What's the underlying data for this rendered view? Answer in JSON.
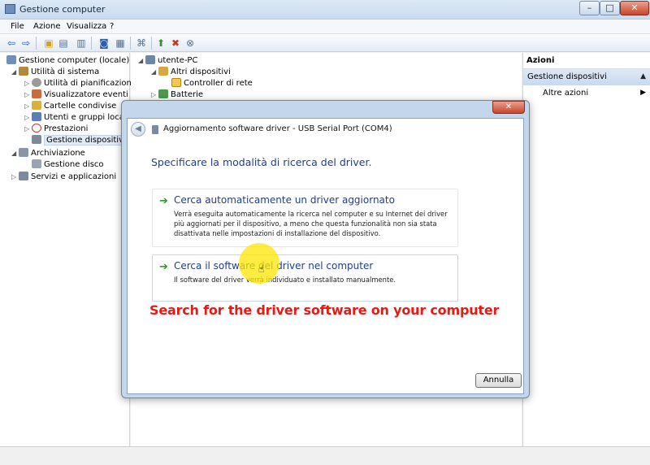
{
  "window": {
    "title": "Gestione computer",
    "controls": {
      "minimize": "–",
      "maximize": "□",
      "close": "✕"
    }
  },
  "menu": [
    "File",
    "Azione",
    "Visualizza",
    "?"
  ],
  "tree_left": [
    {
      "label": "Gestione computer (locale)",
      "icon": "computer-management-icon",
      "expander": ""
    },
    {
      "label": "Utilità di sistema",
      "icon": "system-tools-icon",
      "expander": "◢"
    },
    {
      "label": "Utilità di pianificazione",
      "icon": "task-scheduler-icon",
      "expander": "▷"
    },
    {
      "label": "Visualizzatore eventi",
      "icon": "event-viewer-icon",
      "expander": "▷"
    },
    {
      "label": "Cartelle condivise",
      "icon": "shared-folders-icon",
      "expander": "▷"
    },
    {
      "label": "Utenti e gruppi locali",
      "icon": "users-groups-icon",
      "expander": "▷"
    },
    {
      "label": "Prestazioni",
      "icon": "performance-icon",
      "expander": "▷"
    },
    {
      "label": "Gestione dispositivi",
      "icon": "device-manager-icon",
      "expander": "",
      "selected": true
    },
    {
      "label": "Archiviazione",
      "icon": "storage-icon",
      "expander": "◢"
    },
    {
      "label": "Gestione disco",
      "icon": "disk-management-icon",
      "expander": ""
    },
    {
      "label": "Servizi e applicazioni",
      "icon": "services-apps-icon",
      "expander": "▷"
    }
  ],
  "tree_center": [
    {
      "label": "utente-PC",
      "icon": "computer-icon",
      "expander": "◢"
    },
    {
      "label": "Altri dispositivi",
      "icon": "other-devices-icon",
      "expander": "◢"
    },
    {
      "label": "Controller di rete",
      "icon": "network-controller-warning-icon",
      "expander": ""
    },
    {
      "label": "Batterie",
      "icon": "battery-icon",
      "expander": "▷"
    }
  ],
  "actions": {
    "header": "Azioni",
    "section": "Gestione dispositivi",
    "item": "Altre azioni"
  },
  "dialog": {
    "title": "Aggiornamento software driver - USB Serial Port (COM4)",
    "close": "✕",
    "heading": "Specificare la modalità di ricerca del driver.",
    "options": [
      {
        "title": "Cerca automaticamente un driver aggiornato",
        "description": "Verrà eseguita automaticamente la ricerca nel computer e su Internet dei driver più aggiornati per il dispositivo, a meno che questa funzionalità non sia stata disattivata nelle impostazioni di installazione del dispositivo."
      },
      {
        "title": "Cerca il software del driver nel computer",
        "description": "Il software del driver verrà individuato e installato manualmente."
      }
    ],
    "cancel": "Annulla"
  },
  "caption": "Search for the driver software on your computer"
}
